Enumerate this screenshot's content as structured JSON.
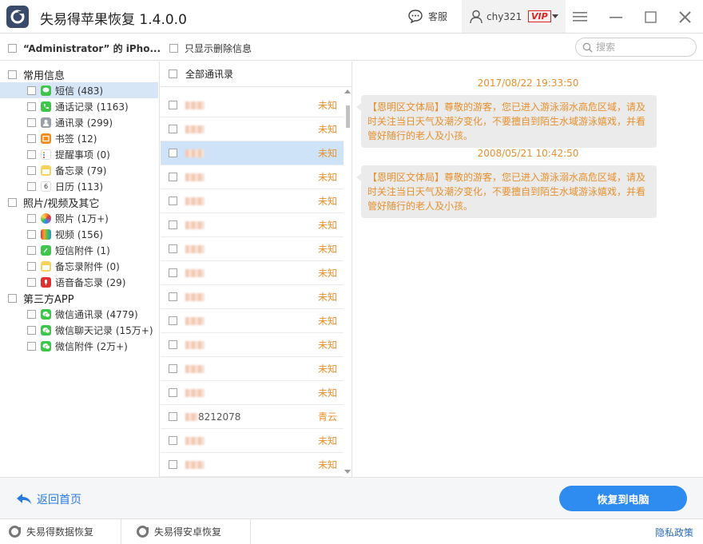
{
  "app": {
    "title": "失易得苹果恢复  1.4.0.0"
  },
  "titlebar": {
    "service_label": "客服",
    "username": "chy321",
    "vip_label": "VIP"
  },
  "filter": {
    "device_label": "“Administrator” 的 iPho...",
    "deleted_only_label": "只显示删除信息",
    "search_placeholder": "搜索"
  },
  "tree": {
    "categories": [
      {
        "label": "常用信息",
        "items": [
          {
            "label": "短信 (483)",
            "icon": "sms-icon",
            "color": "#3ec64a"
          },
          {
            "label": "通话记录 (1163)",
            "icon": "phone-icon",
            "color": "#3ec64a"
          },
          {
            "label": "通讯录 (299)",
            "icon": "contacts-icon",
            "color": "#9aa0a8"
          },
          {
            "label": "书签 (12)",
            "icon": "bookmark-icon",
            "color": "#f08c1e"
          },
          {
            "label": "提醒事项 (0)",
            "icon": "reminder-icon",
            "color": "#ffffff"
          },
          {
            "label": "备忘录 (79)",
            "icon": "notes-icon",
            "color": "#f5d35a"
          },
          {
            "label": "日历 (113)",
            "icon": "calendar-icon",
            "color": "#ffffff"
          }
        ]
      },
      {
        "label": "照片/视频及其它",
        "items": [
          {
            "label": "照片 (1万+)",
            "icon": "photos-icon",
            "color": "#f4a233"
          },
          {
            "label": "视频 (156)",
            "icon": "video-icon",
            "color": "#2c2c2c"
          },
          {
            "label": "短信附件 (1)",
            "icon": "attachment-icon",
            "color": "#3ec64a"
          },
          {
            "label": "备忘录附件 (0)",
            "icon": "notes-attachment-icon",
            "color": "#f5d35a"
          },
          {
            "label": "语音备忘录 (29)",
            "icon": "voice-memo-icon",
            "color": "#e03030"
          }
        ]
      },
      {
        "label": "第三方APP",
        "items": [
          {
            "label": "微信通讯录 (4779)",
            "icon": "wechat-contacts-icon",
            "color": "#3ec64a"
          },
          {
            "label": "微信聊天记录 (15万+)",
            "icon": "wechat-chat-icon",
            "color": "#3ec64a"
          },
          {
            "label": "微信附件 (2万+)",
            "icon": "wechat-attachment-icon",
            "color": "#3ec64a"
          }
        ]
      }
    ]
  },
  "contacts": {
    "header_label": "全部通讯录",
    "rows": [
      {
        "name": "",
        "status": "未知"
      },
      {
        "name": "",
        "status": "未知"
      },
      {
        "name": "",
        "status": "未知"
      },
      {
        "name": "",
        "status": "未知"
      },
      {
        "name": "",
        "status": "未知"
      },
      {
        "name": "",
        "status": "未知"
      },
      {
        "name": "",
        "status": "未知"
      },
      {
        "name": "",
        "status": "未知"
      },
      {
        "name": "",
        "status": "未知"
      },
      {
        "name": "",
        "status": "未知"
      },
      {
        "name": "",
        "status": "未知"
      },
      {
        "name": "",
        "status": "未知"
      },
      {
        "name": "",
        "status": "未知"
      },
      {
        "name": "8212078",
        "status": "青云"
      },
      {
        "name": "",
        "status": "未知"
      },
      {
        "name": "",
        "status": "未知"
      }
    ]
  },
  "messages": [
    {
      "time": "2017/08/22 19:33:50",
      "text": "【恩明区文体局】尊敬的游客，您已进入游泳溺水高危区域，请及时关注当日天气及潮汐变化，不要擅自到陌生水域游泳嬉戏，并看管好随行的老人及小孩。"
    },
    {
      "time": "2008/05/21 10:42:50",
      "text": "【恩明区文体局】尊敬的游客，您已进入游泳溺水高危区域，请及时关注当日天气及潮汐变化，不要擅自到陌生水域游泳嬉戏，并看管好随行的老人及小孩。"
    }
  ],
  "bottom": {
    "back_label": "返回首页",
    "recover_label": "恢复到电脑"
  },
  "footer": {
    "link1": "失易得数据恢复",
    "link2": "失易得安卓恢复",
    "privacy": "隐私政策"
  },
  "colors": {
    "accent": "#2e8bf0",
    "status_orange": "#e8902c",
    "selected_row": "#cfe3f8"
  }
}
